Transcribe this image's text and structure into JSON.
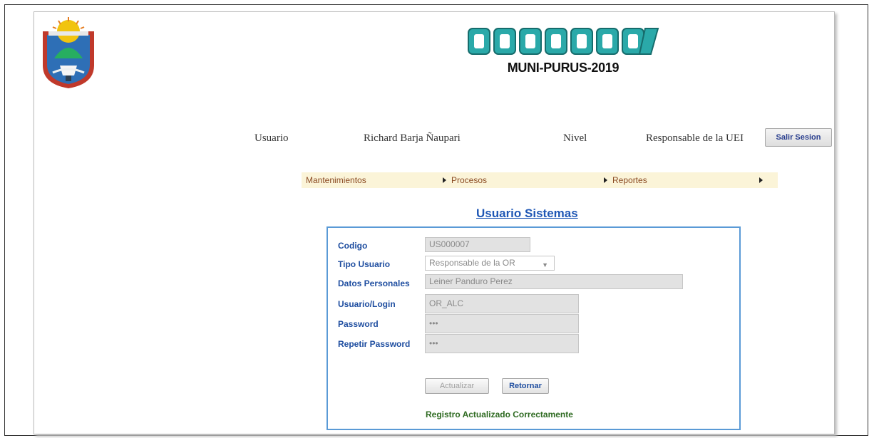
{
  "header": {
    "subtitle": "MUNI-PURUS-2019"
  },
  "user_info": {
    "user_label": "Usuario",
    "user_name": "Richard Barja Ñaupari",
    "level_label": "Nivel",
    "level_value": "Responsable de la UEI",
    "logout_label": "Salir Sesion"
  },
  "menu": {
    "items": [
      {
        "label": "Mantenimientos"
      },
      {
        "label": "Procesos"
      },
      {
        "label": "Reportes"
      }
    ]
  },
  "form": {
    "title": "Usuario Sistemas",
    "fields": [
      {
        "label": "Codigo",
        "value": "US000007"
      },
      {
        "label": "Tipo Usuario",
        "value": "Responsable de la OR"
      },
      {
        "label": "Datos Personales",
        "value": "Leiner Panduro Perez"
      },
      {
        "label": "Usuario/Login",
        "value": "OR_ALC"
      },
      {
        "label": "Password",
        "value": "•••"
      },
      {
        "label": "Repetir Password",
        "value": "•••"
      }
    ],
    "update_label": "Actualizar",
    "return_label": "Retornar",
    "status": "Registro Actualizado Correctamente"
  },
  "colors": {
    "accent": "#1f57b5",
    "menu_bg": "#fbf4d8",
    "status_ok": "#2f6b22",
    "form_border": "#5a9ad6"
  }
}
